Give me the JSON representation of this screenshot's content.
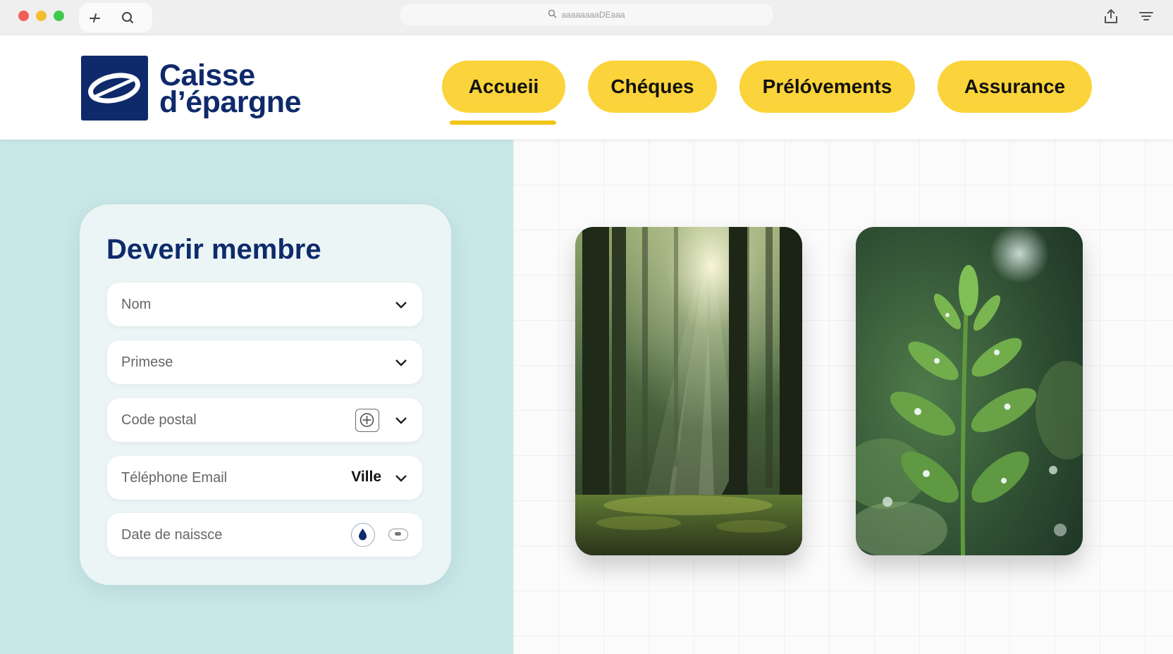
{
  "browser": {
    "url": "aaaaaaaaDEaaa",
    "icons": [
      "back-icon",
      "search-icon",
      "share-icon",
      "menu-icon"
    ]
  },
  "brand": {
    "name_line1": "Caisse",
    "name_line2": "d’épargne",
    "color": "#0f2a6b"
  },
  "nav": {
    "items": [
      {
        "label": "Accueii",
        "active": true
      },
      {
        "label": "Chéques"
      },
      {
        "label": "Prélóvements"
      },
      {
        "label": "Assurance"
      }
    ],
    "accent": "#fbd33a"
  },
  "form": {
    "title": "Deverir membre",
    "fields": [
      {
        "label": "Nom"
      },
      {
        "label": "Primese"
      },
      {
        "label": "Code postal"
      },
      {
        "label": "Téléphone Email",
        "value": "Ville"
      },
      {
        "label": "Date de naissce"
      }
    ]
  },
  "images": [
    {
      "subject": "forest with sun rays"
    },
    {
      "subject": "green plant with dew drops"
    }
  ],
  "colors": {
    "left_panel": "#c9e7e7",
    "brand_navy": "#0f2a6b",
    "nav_yellow": "#fbd33a"
  }
}
